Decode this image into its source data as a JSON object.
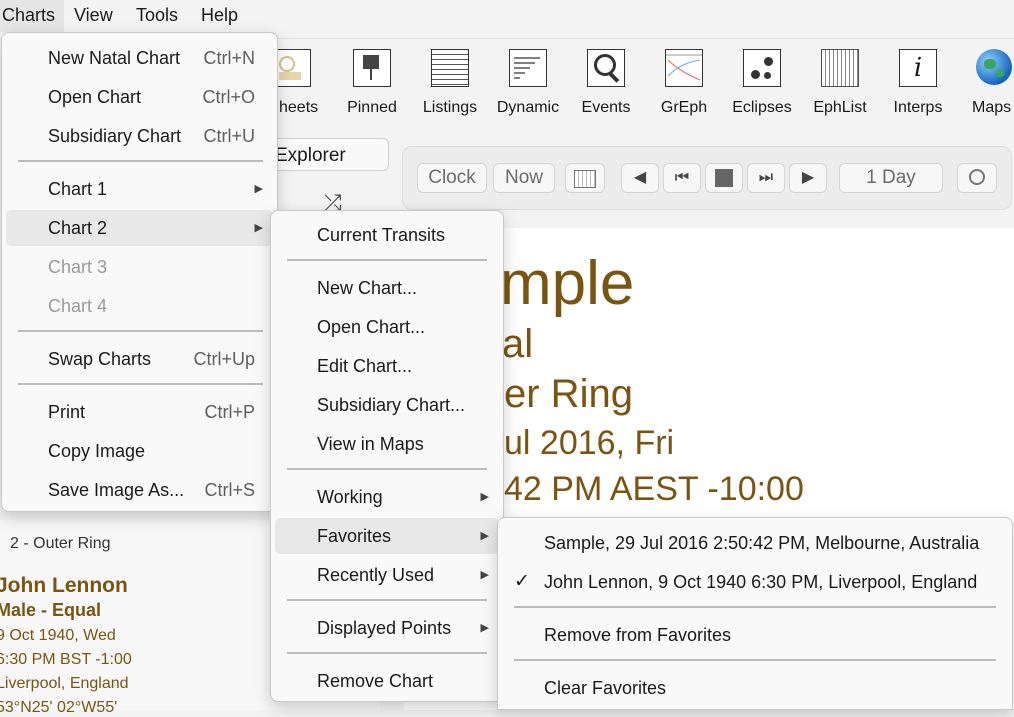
{
  "menubar": {
    "items": [
      "Charts",
      "View",
      "Tools",
      "Help"
    ]
  },
  "toolbar": {
    "buttons": [
      "heets",
      "Pinned",
      "Listings",
      "Dynamic",
      "Events",
      "GrEph",
      "Eclipses",
      "EphList",
      "Interps",
      "Maps"
    ]
  },
  "explorer_tab": "Explorer",
  "nav": {
    "clock": "Clock",
    "now": "Now",
    "interval": "1 Day"
  },
  "content": {
    "line1": "mple",
    "line2": "al",
    "line3": "er Ring",
    "line4": "ul 2016, Fri",
    "line5": "42 PM AEST -10:00"
  },
  "left_panel": {
    "ring_label": "2 - Outer Ring",
    "name": "John Lennon",
    "line2": "Male - Equal",
    "line3": "9 Oct 1940, Wed",
    "line4": "6:30 PM BST -1:00",
    "line5": "Liverpool, England",
    "line6": "53°N25' 02°W55'"
  },
  "charts_menu": {
    "new_natal": {
      "label": "New Natal Chart",
      "shortcut": "Ctrl+N"
    },
    "open_chart": {
      "label": "Open Chart",
      "shortcut": "Ctrl+O"
    },
    "subsidiary": {
      "label": "Subsidiary Chart",
      "shortcut": "Ctrl+U"
    },
    "chart1": "Chart 1",
    "chart2": "Chart 2",
    "chart3": "Chart 3",
    "chart4": "Chart 4",
    "swap": {
      "label": "Swap Charts",
      "shortcut": "Ctrl+Up"
    },
    "print": {
      "label": "Print",
      "shortcut": "Ctrl+P"
    },
    "copy_image": {
      "label": "Copy Image"
    },
    "save_image": {
      "label": "Save Image As...",
      "shortcut": "Ctrl+S"
    }
  },
  "chart2_menu": {
    "current_transits": "Current Transits",
    "new_chart": "New Chart...",
    "open_chart": "Open Chart...",
    "edit_chart": "Edit Chart...",
    "subsidiary_chart": "Subsidiary Chart...",
    "view_in_maps": "View in Maps",
    "working": "Working",
    "favorites": "Favorites",
    "recently_used": "Recently Used",
    "displayed_points": "Displayed Points",
    "remove_chart": "Remove Chart"
  },
  "favorites_menu": {
    "fav1": "Sample, 29 Jul 2016 2:50:42 PM, Melbourne, Australia",
    "fav2": "John Lennon, 9 Oct 1940 6:30 PM, Liverpool, England",
    "check": "✓",
    "remove": "Remove from Favorites",
    "clear": "Clear Favorites"
  }
}
